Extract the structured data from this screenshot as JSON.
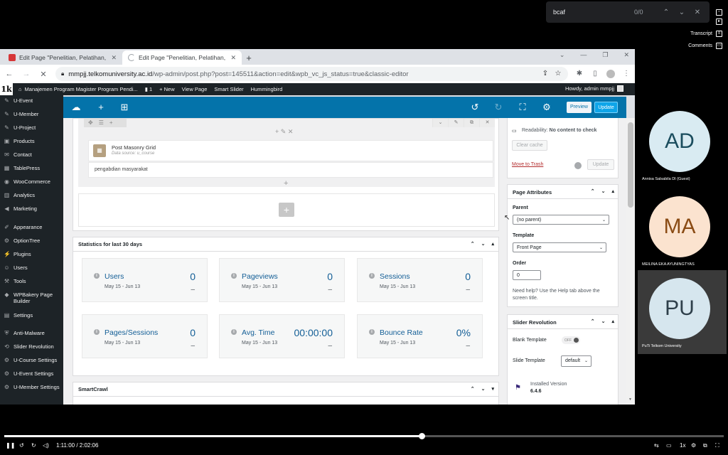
{
  "findbar": {
    "query": "bcaf",
    "count": "0/0"
  },
  "overlay_tools": {
    "transcript": "Transcript",
    "comments": "Comments"
  },
  "browser": {
    "tabs": [
      {
        "title": "Edit Page \"Penelitian, Pelatihan, d",
        "active": false
      },
      {
        "title": "Edit Page \"Penelitian, Pelatihan, d",
        "active": true
      }
    ],
    "url_host": "mmpjj.telkomuniversity.ac.id",
    "url_path": "/wp-admin/post.php?post=145511&action=edit&wpb_vc_js_status=true&classic-editor"
  },
  "adminbar": {
    "logo": "1k",
    "site": "Manajemen Program Magister Program Pendi...",
    "comments": "1",
    "new": "New",
    "view_page": "View Page",
    "smart_slider": "Smart Slider",
    "hummingbird": "Hummingbird",
    "howdy": "Howdy, admin mmpjj"
  },
  "sidebar": {
    "items": [
      {
        "label": "U-Event",
        "icon": "pin-icon"
      },
      {
        "label": "U-Member",
        "icon": "pin-icon"
      },
      {
        "label": "U-Project",
        "icon": "pin-icon"
      },
      {
        "label": "Products",
        "icon": "products-icon"
      },
      {
        "label": "Contact",
        "icon": "mail-icon"
      },
      {
        "label": "TablePress",
        "icon": "table-icon"
      },
      {
        "label": "WooCommerce",
        "icon": "woocommerce-icon"
      },
      {
        "label": "Analytics",
        "icon": "analytics-icon"
      },
      {
        "label": "Marketing",
        "icon": "megaphone-icon"
      },
      {
        "label": "Appearance",
        "icon": "brush-icon"
      },
      {
        "label": "OptionTree",
        "icon": "gear-icon"
      },
      {
        "label": "Plugins",
        "icon": "plug-icon"
      },
      {
        "label": "Users",
        "icon": "user-icon"
      },
      {
        "label": "Tools",
        "icon": "wrench-icon"
      },
      {
        "label": "WPBakery Page Builder",
        "icon": "wpbakery-icon"
      },
      {
        "label": "Settings",
        "icon": "settings-icon"
      },
      {
        "label": "Anti-Malware",
        "icon": "shield-icon"
      },
      {
        "label": "Slider Revolution",
        "icon": "slider-icon"
      },
      {
        "label": "U-Course Settings",
        "icon": "gear-icon"
      },
      {
        "label": "U-Event Settings",
        "icon": "gear-icon"
      },
      {
        "label": "U-Member Settings",
        "icon": "gear-icon"
      }
    ]
  },
  "vcbar": {
    "preview": "Preview",
    "update": "Update"
  },
  "editor": {
    "element_title": "Post Masonry Grid",
    "element_source": "Data source: u_course",
    "text_block": "pengabdian masyarakat"
  },
  "stats": {
    "title": "Statistics for last 30 days",
    "cards": [
      {
        "name": "Users",
        "date": "May 15 - Jun 13",
        "value": "0",
        "dash": "–"
      },
      {
        "name": "Pageviews",
        "date": "May 15 - Jun 13",
        "value": "0",
        "dash": "–"
      },
      {
        "name": "Sessions",
        "date": "May 15 - Jun 13",
        "value": "0",
        "dash": "–"
      },
      {
        "name": "Pages/Sessions",
        "date": "May 15 - Jun 13",
        "value": "0",
        "dash": "–"
      },
      {
        "name": "Avg. Time",
        "date": "May 15 - Jun 13",
        "value": "00:00:00",
        "dash": "–"
      },
      {
        "name": "Bounce Rate",
        "date": "May 15 - Jun 13",
        "value": "0%",
        "dash": "–"
      }
    ]
  },
  "smartcrawl": {
    "title": "SmartCrawl"
  },
  "publish": {
    "readability_label": "Readability:",
    "readability_value": "No content to check",
    "clear_cache": "Clear cache",
    "move_to_trash": "Move to Trash",
    "update": "Update"
  },
  "page_attributes": {
    "title": "Page Attributes",
    "parent_label": "Parent",
    "parent_value": "(no parent)",
    "template_label": "Template",
    "template_value": "Front Page",
    "order_label": "Order",
    "order_value": "0",
    "help": "Need help? Use the Help tab above the screen title."
  },
  "slider_revolution": {
    "title": "Slider Revolution",
    "blank_template": "Blank Template",
    "toggle": "OFF",
    "slide_template": "Slide Template",
    "slide_template_value": "default",
    "installed_label": "Installed Version",
    "installed_value": "6.4.6"
  },
  "participants": [
    {
      "initials": "AD",
      "name": "Annisa Salsabila DI (Guest)",
      "bg": "#d9ebf2",
      "fg": "#1b4d5e"
    },
    {
      "initials": "MA",
      "name": "MEILINA EKA AYUNINGTYAS",
      "bg": "#fbe3cf",
      "fg": "#8a4b14"
    },
    {
      "initials": "PU",
      "name": "PuTi Telkom University",
      "bg": "#d6e6ee",
      "fg": "#2e3f4a"
    }
  ],
  "player": {
    "time": "1:11:00 / 2:02:06",
    "speed": "1x",
    "progress": 0.58
  }
}
